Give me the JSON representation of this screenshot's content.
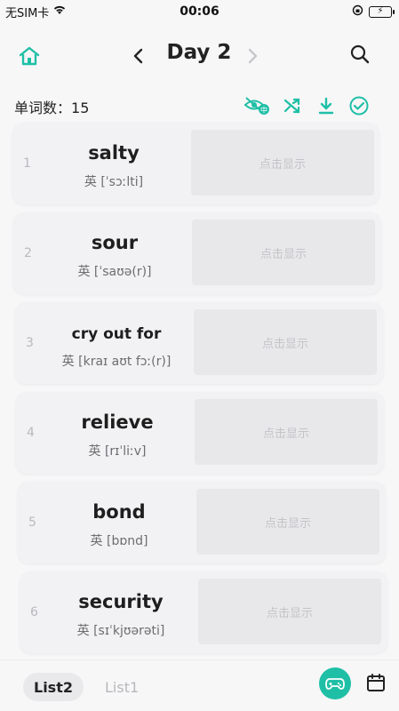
{
  "status_bar": {
    "carrier": "无SIM卡",
    "time": "00:06"
  },
  "nav": {
    "title": "Day 2",
    "home_icon": "home-icon",
    "prev_icon": "chevron-left-icon",
    "next_icon": "chevron-right-icon",
    "search_icon": "search-icon"
  },
  "toolbar": {
    "word_count_label": "单词数：",
    "word_count": "15",
    "tools": [
      "hide-chinese-icon",
      "shuffle-icon",
      "download-icon",
      "check-circle-icon"
    ]
  },
  "words": [
    {
      "index": "1",
      "word": "salty",
      "phonetic": "英 [ˈsɔːlti]",
      "reveal_label": "点击显示"
    },
    {
      "index": "2",
      "word": "sour",
      "phonetic": "英 [ˈsaʊə(r)]",
      "reveal_label": "点击显示"
    },
    {
      "index": "3",
      "word": "cry out for",
      "phonetic": "英 [kraɪ aʊt fɔː(r)]",
      "reveal_label": "点击显示"
    },
    {
      "index": "4",
      "word": "relieve",
      "phonetic": "英 [rɪˈliːv]",
      "reveal_label": "点击显示"
    },
    {
      "index": "5",
      "word": "bond",
      "phonetic": "英 [bɒnd]",
      "reveal_label": "点击显示"
    },
    {
      "index": "6",
      "word": "security",
      "phonetic": "英 [sɪˈkjʊərəti]",
      "reveal_label": "点击显示"
    }
  ],
  "bottom": {
    "tabs": [
      {
        "label": "List2",
        "active": true
      },
      {
        "label": "List1",
        "active": false
      }
    ],
    "game_icon": "gamepad-icon",
    "calendar_icon": "calendar-icon"
  },
  "colors": {
    "accent": "#1fbfa6",
    "text": "#222222",
    "muted": "#b9b9bd"
  }
}
